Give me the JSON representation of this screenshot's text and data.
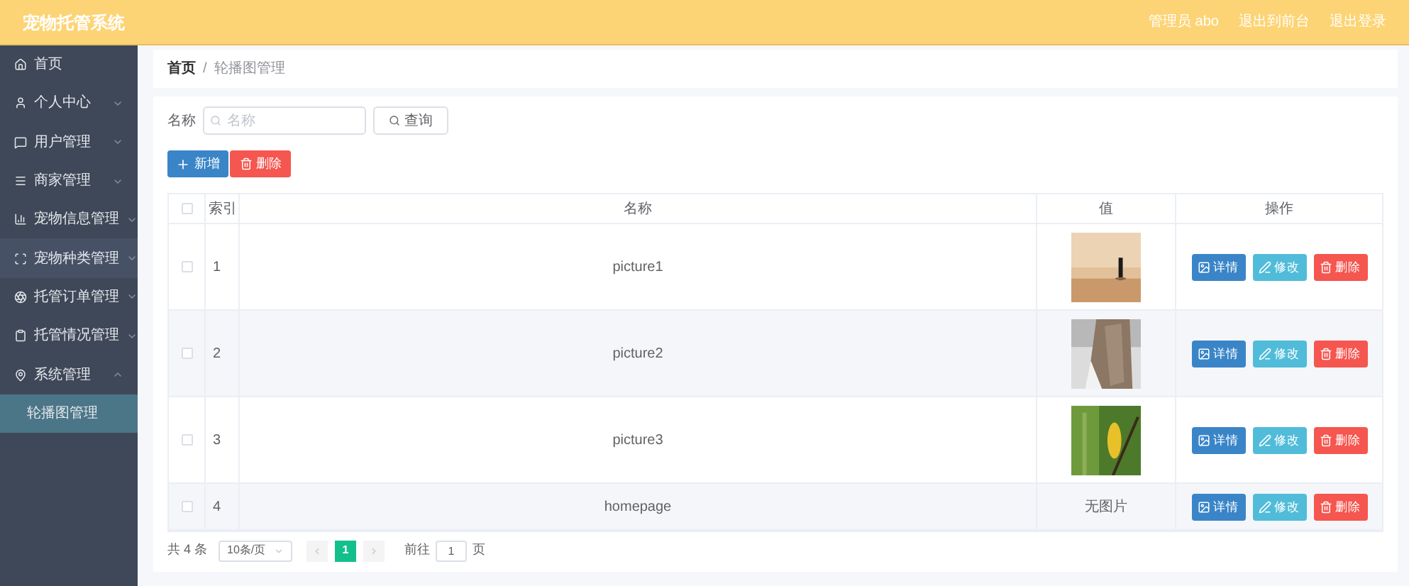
{
  "header": {
    "title": "宠物托管系统",
    "links": [
      "管理员 abo",
      "退出到前台",
      "退出登录"
    ]
  },
  "sidebar": {
    "items": [
      {
        "label": "首页",
        "expandable": false,
        "hovered": false
      },
      {
        "label": "个人中心",
        "expandable": true,
        "expanded": false,
        "hovered": false
      },
      {
        "label": "用户管理",
        "expandable": true,
        "expanded": false,
        "hovered": false
      },
      {
        "label": "商家管理",
        "expandable": true,
        "expanded": false,
        "hovered": false
      },
      {
        "label": "宠物信息管理",
        "expandable": true,
        "expanded": false,
        "hovered": false
      },
      {
        "label": "宠物种类管理",
        "expandable": true,
        "expanded": false,
        "hovered": true
      },
      {
        "label": "托管订单管理",
        "expandable": true,
        "expanded": false,
        "hovered": false
      },
      {
        "label": "托管情况管理",
        "expandable": true,
        "expanded": false,
        "hovered": false
      },
      {
        "label": "系统管理",
        "expandable": true,
        "expanded": true,
        "hovered": false,
        "children": [
          {
            "label": "轮播图管理",
            "selected": true
          }
        ]
      }
    ]
  },
  "breadcrumb": [
    "首页",
    "/",
    "轮播图管理"
  ],
  "search": {
    "label": "名称",
    "placeholder": "名称",
    "button": "查询"
  },
  "actions": [
    {
      "kind": "add",
      "label": "新增"
    },
    {
      "kind": "delete",
      "label": "删除"
    }
  ],
  "table": {
    "columns": [
      "索引",
      "名称",
      "值",
      "操作"
    ],
    "all_checked": false,
    "rows": [
      {
        "checked": false,
        "index": "1",
        "name": "picture1",
        "value": {
          "kind": "picture"
        },
        "actions": [
          {
            "kind": "detail",
            "label": "详情"
          },
          {
            "kind": "edit",
            "label": "修改"
          },
          {
            "kind": "delete",
            "label": "删除"
          }
        ]
      },
      {
        "checked": false,
        "index": "2",
        "name": "picture2",
        "value": {
          "kind": "picture"
        },
        "actions": [
          {
            "kind": "detail",
            "label": "详情"
          },
          {
            "kind": "edit",
            "label": "修改"
          },
          {
            "kind": "delete",
            "label": "删除"
          }
        ]
      },
      {
        "checked": false,
        "index": "3",
        "name": "picture3",
        "value": {
          "kind": "picture"
        },
        "actions": [
          {
            "kind": "detail",
            "label": "详情"
          },
          {
            "kind": "edit",
            "label": "修改"
          },
          {
            "kind": "delete",
            "label": "删除"
          }
        ]
      },
      {
        "checked": false,
        "index": "4",
        "name": "homepage",
        "value": {
          "kind": "text",
          "text": "无图片"
        },
        "actions": [
          {
            "kind": "detail",
            "label": "详情"
          },
          {
            "kind": "edit",
            "label": "修改"
          },
          {
            "kind": "delete",
            "label": "删除"
          }
        ]
      }
    ]
  },
  "pagination": {
    "total": "共 4 条",
    "page_size": "10条/页",
    "pages": [
      {
        "label": "1",
        "selected": true
      }
    ],
    "goto_label": "前往",
    "goto_value": "1",
    "goto_suffix": "页"
  }
}
